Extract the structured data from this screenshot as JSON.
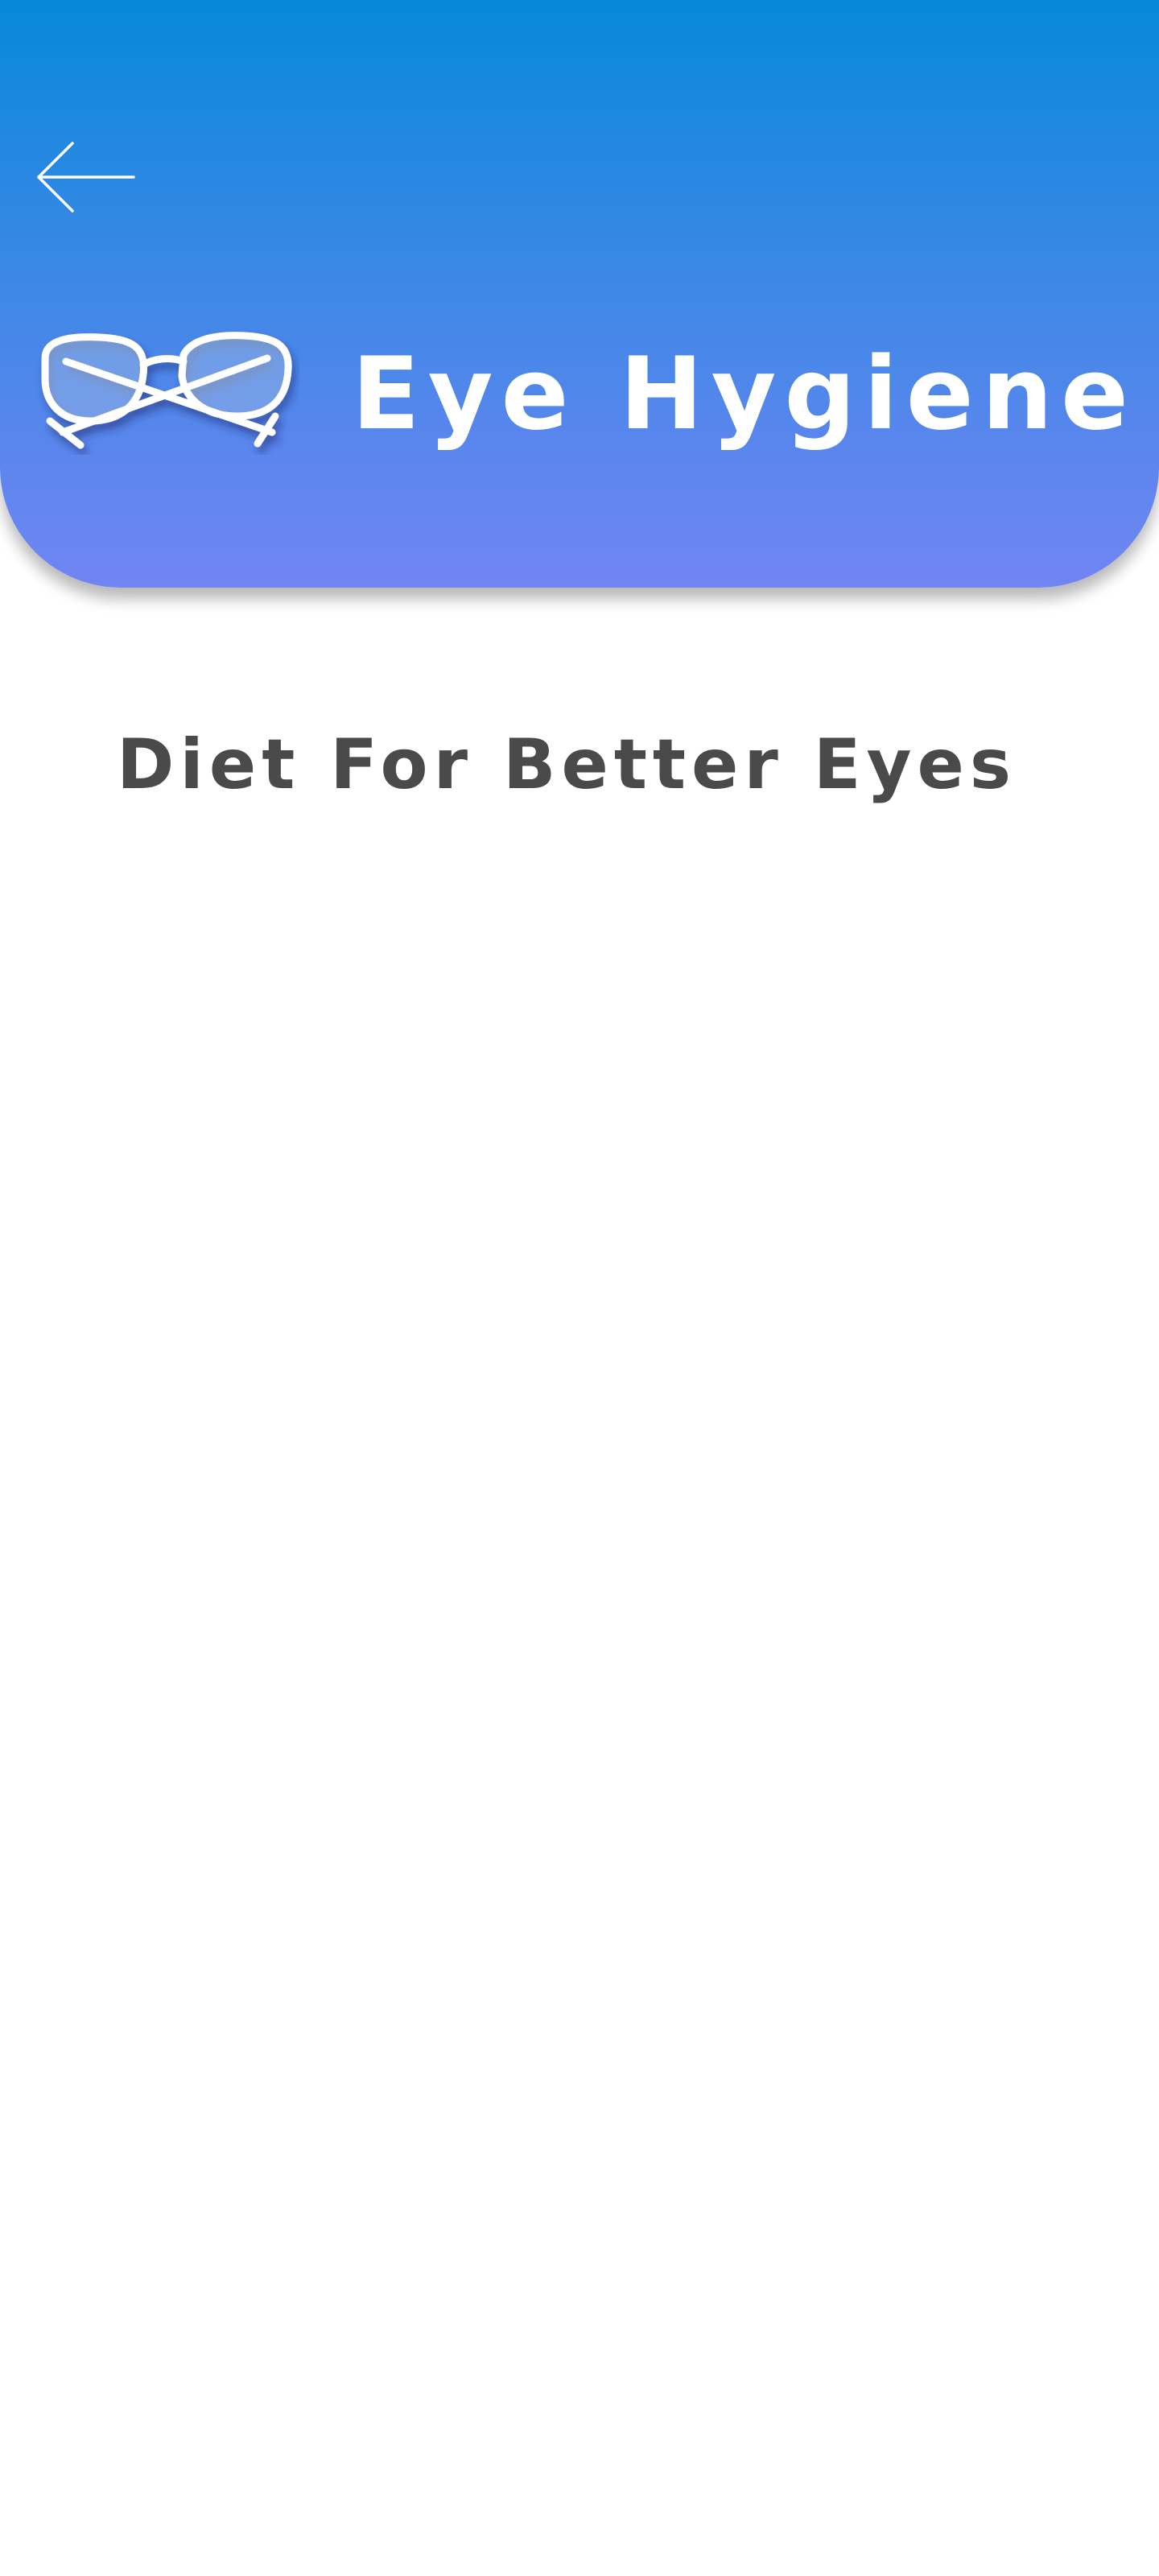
{
  "header": {
    "back_icon": "arrow-left-icon",
    "logo_icon": "eyeglasses-icon",
    "title": "Eye Hygiene"
  },
  "content": {
    "section_title": "Diet For Better Eyes"
  },
  "colors": {
    "header_gradient_top": "#0689d8",
    "header_gradient_bottom": "#7285f2",
    "section_title_text": "#4a4a4a",
    "background": "#ffffff"
  }
}
